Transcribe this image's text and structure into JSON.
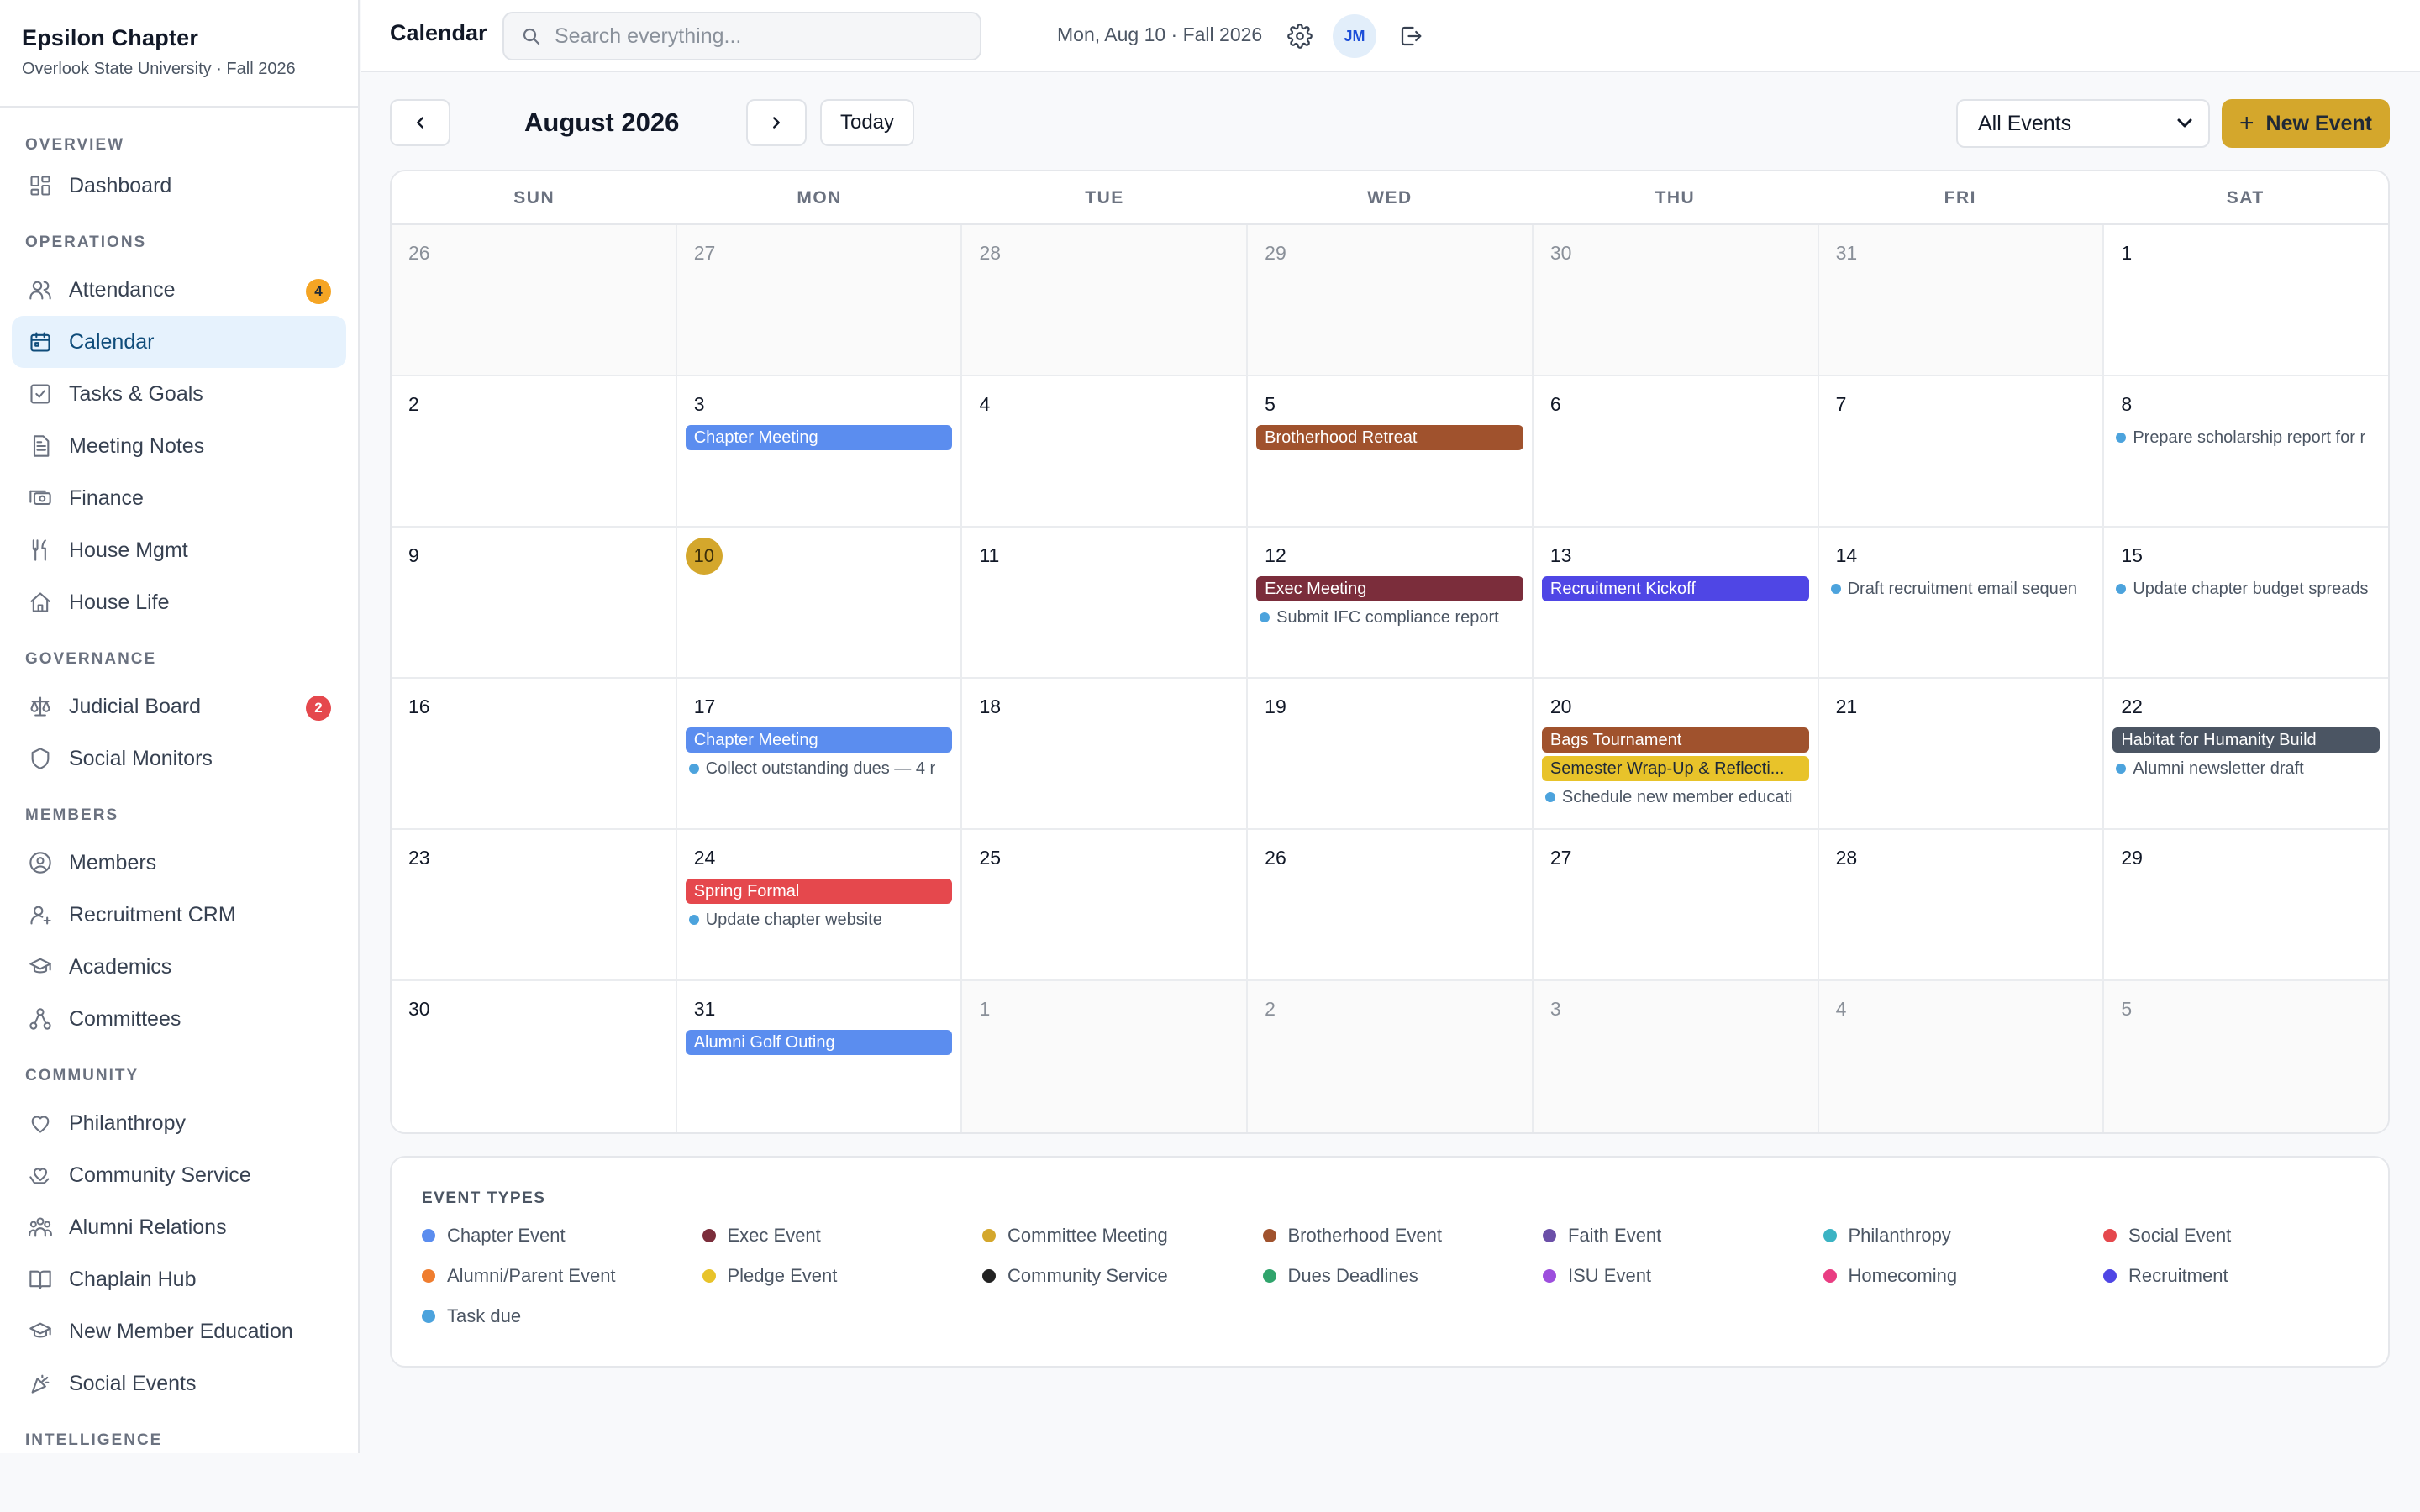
{
  "sidebar": {
    "org_name": "Epsilon Chapter",
    "org_sub": "Overlook State University · Fall 2026",
    "sections": [
      {
        "label": "OVERVIEW",
        "items": [
          {
            "label": "Dashboard",
            "icon": "dashboard-icon"
          }
        ]
      },
      {
        "label": "OPERATIONS",
        "items": [
          {
            "label": "Attendance",
            "icon": "users-icon",
            "badge": "4",
            "badge_color": "#f5a524"
          },
          {
            "label": "Calendar",
            "icon": "calendar-icon",
            "active": true
          },
          {
            "label": "Tasks & Goals",
            "icon": "checkbox-icon"
          },
          {
            "label": "Meeting Notes",
            "icon": "document-icon"
          },
          {
            "label": "Finance",
            "icon": "money-icon"
          },
          {
            "label": "House Mgmt",
            "icon": "utensils-icon"
          },
          {
            "label": "House Life",
            "icon": "home-icon"
          }
        ]
      },
      {
        "label": "GOVERNANCE",
        "items": [
          {
            "label": "Judicial Board",
            "icon": "scale-icon",
            "badge": "2",
            "badge_color": "#e5484d"
          },
          {
            "label": "Social Monitors",
            "icon": "shield-icon"
          }
        ]
      },
      {
        "label": "MEMBERS",
        "items": [
          {
            "label": "Members",
            "icon": "user-circle-icon"
          },
          {
            "label": "Recruitment CRM",
            "icon": "user-plus-icon"
          },
          {
            "label": "Academics",
            "icon": "graduation-cap-icon"
          },
          {
            "label": "Committees",
            "icon": "network-icon"
          }
        ]
      },
      {
        "label": "COMMUNITY",
        "items": [
          {
            "label": "Philanthropy",
            "icon": "heart-icon"
          },
          {
            "label": "Community Service",
            "icon": "hand-heart-icon"
          },
          {
            "label": "Alumni Relations",
            "icon": "people-icon"
          },
          {
            "label": "Chaplain Hub",
            "icon": "book-open-icon"
          },
          {
            "label": "New Member Education",
            "icon": "graduation-cap-icon"
          },
          {
            "label": "Social Events",
            "icon": "party-icon"
          }
        ]
      },
      {
        "label": "INTELLIGENCE",
        "items": []
      }
    ]
  },
  "topbar": {
    "title": "Calendar",
    "search_placeholder": "Search everything...",
    "date_text": "Mon, Aug 10 · Fall 2026",
    "avatar_initials": "JM"
  },
  "toolbar": {
    "month_title": "August 2026",
    "today_label": "Today",
    "filter_value": "All Events",
    "new_event_label": "New Event"
  },
  "calendar": {
    "weekdays": [
      "SUN",
      "MON",
      "TUE",
      "WED",
      "THU",
      "FRI",
      "SAT"
    ],
    "today": 10,
    "weeks": [
      [
        {
          "day": "26",
          "other": true
        },
        {
          "day": "27",
          "other": true
        },
        {
          "day": "28",
          "other": true
        },
        {
          "day": "29",
          "other": true
        },
        {
          "day": "30",
          "other": true
        },
        {
          "day": "31",
          "other": true
        },
        {
          "day": "1"
        }
      ],
      [
        {
          "day": "2"
        },
        {
          "day": "3",
          "events": [
            {
              "title": "Chapter Meeting",
              "color": "#5b8def"
            }
          ]
        },
        {
          "day": "4"
        },
        {
          "day": "5",
          "events": [
            {
              "title": "Brotherhood Retreat",
              "color": "#a0522d"
            }
          ]
        },
        {
          "day": "6"
        },
        {
          "day": "7"
        },
        {
          "day": "8",
          "tasks": [
            "Prepare scholarship report for r"
          ]
        }
      ],
      [
        {
          "day": "9"
        },
        {
          "day": "10",
          "today": true
        },
        {
          "day": "11"
        },
        {
          "day": "12",
          "events": [
            {
              "title": "Exec Meeting",
              "color": "#7b2d3b"
            }
          ],
          "tasks": [
            "Submit IFC compliance report"
          ]
        },
        {
          "day": "13",
          "events": [
            {
              "title": "Recruitment Kickoff",
              "color": "#4f46e5"
            }
          ]
        },
        {
          "day": "14",
          "tasks": [
            "Draft recruitment email sequen"
          ]
        },
        {
          "day": "15",
          "tasks": [
            "Update chapter budget spreads"
          ]
        }
      ],
      [
        {
          "day": "16"
        },
        {
          "day": "17",
          "events": [
            {
              "title": "Chapter Meeting",
              "color": "#5b8def"
            }
          ],
          "tasks": [
            "Collect outstanding dues — 4 r"
          ]
        },
        {
          "day": "18"
        },
        {
          "day": "19"
        },
        {
          "day": "20",
          "events": [
            {
              "title": "Bags Tournament",
              "color": "#a0522d"
            },
            {
              "title": "Semester Wrap-Up & Reflecti...",
              "color": "#e8c32a",
              "dark": true
            }
          ],
          "tasks": [
            "Schedule new member educati"
          ]
        },
        {
          "day": "21"
        },
        {
          "day": "22",
          "events": [
            {
              "title": "Habitat for Humanity Build",
              "color": "#4b5563"
            }
          ],
          "tasks": [
            "Alumni newsletter draft"
          ]
        }
      ],
      [
        {
          "day": "23"
        },
        {
          "day": "24",
          "events": [
            {
              "title": "Spring Formal",
              "color": "#e5484d"
            }
          ],
          "tasks": [
            "Update chapter website"
          ]
        },
        {
          "day": "25"
        },
        {
          "day": "26"
        },
        {
          "day": "27"
        },
        {
          "day": "28"
        },
        {
          "day": "29"
        }
      ],
      [
        {
          "day": "30"
        },
        {
          "day": "31",
          "events": [
            {
              "title": "Alumni Golf Outing",
              "color": "#5b8def"
            }
          ]
        },
        {
          "day": "1",
          "other": true
        },
        {
          "day": "2",
          "other": true
        },
        {
          "day": "3",
          "other": true
        },
        {
          "day": "4",
          "other": true
        },
        {
          "day": "5",
          "other": true
        }
      ]
    ]
  },
  "legend": {
    "title": "EVENT TYPES",
    "items": [
      {
        "label": "Chapter Event",
        "color": "#5b8def"
      },
      {
        "label": "Exec Event",
        "color": "#7b2d3b"
      },
      {
        "label": "Committee Meeting",
        "color": "#d4a72c"
      },
      {
        "label": "Brotherhood Event",
        "color": "#a0522d"
      },
      {
        "label": "Faith Event",
        "color": "#6b4fa8"
      },
      {
        "label": "Philanthropy",
        "color": "#3bb3c3"
      },
      {
        "label": "Social Event",
        "color": "#e5484d"
      },
      {
        "label": "Alumni/Parent Event",
        "color": "#ef7d2f"
      },
      {
        "label": "Pledge Event",
        "color": "#e8c32a"
      },
      {
        "label": "Community Service",
        "color": "#222222"
      },
      {
        "label": "Dues Deadlines",
        "color": "#30a46c"
      },
      {
        "label": "ISU Event",
        "color": "#9d4edd"
      },
      {
        "label": "Homecoming",
        "color": "#e93d82"
      },
      {
        "label": "Recruitment",
        "color": "#4f46e5"
      },
      {
        "label": "Task due",
        "color": "#4ca3dd"
      }
    ]
  }
}
